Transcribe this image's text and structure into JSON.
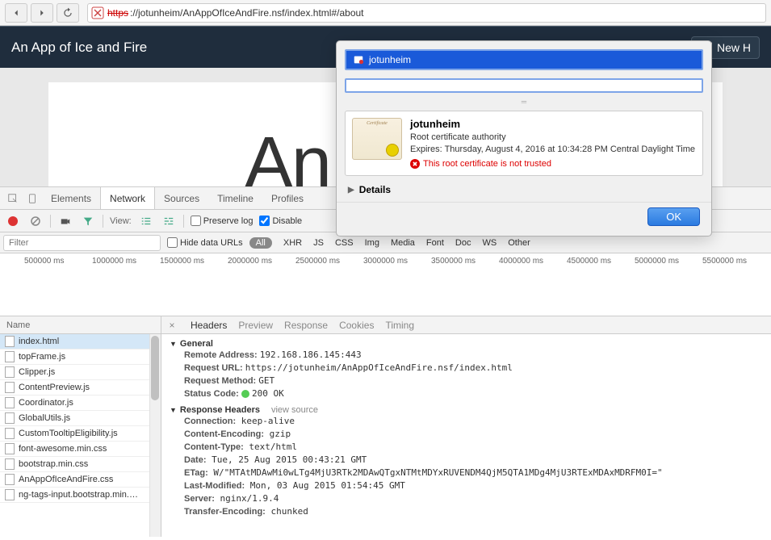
{
  "browser": {
    "url_prefix": "https",
    "url_rest": "://jotunheim/AnAppOfIceAndFire.nsf/index.html#/about"
  },
  "site": {
    "title": "An App of Ice and Fire",
    "new_button": "New H",
    "hero": "An App o"
  },
  "cert": {
    "header_host": "jotunheim",
    "name": "jotunheim",
    "authority": "Root certificate authority",
    "expires": "Expires: Thursday, August 4, 2016 at 10:34:28 PM Central Daylight Time",
    "error": "This root certificate is not trusted",
    "details": "Details",
    "ok": "OK"
  },
  "devtools": {
    "tabs": [
      "Elements",
      "Network",
      "Sources",
      "Timeline",
      "Profiles"
    ],
    "active_tab": 1,
    "toolbar": {
      "view_label": "View:",
      "preserve": "Preserve log",
      "disable": "Disable"
    },
    "filter": {
      "placeholder": "Filter",
      "hide_urls": "Hide data URLs",
      "all": "All",
      "types": [
        "XHR",
        "JS",
        "CSS",
        "Img",
        "Media",
        "Font",
        "Doc",
        "WS",
        "Other"
      ]
    },
    "timeline": [
      "500000 ms",
      "1000000 ms",
      "1500000 ms",
      "2000000 ms",
      "2500000 ms",
      "3000000 ms",
      "3500000 ms",
      "4000000 ms",
      "4500000 ms",
      "5000000 ms",
      "5500000 ms"
    ],
    "name_header": "Name",
    "files": [
      "index.html",
      "topFrame.js",
      "Clipper.js",
      "ContentPreview.js",
      "Coordinator.js",
      "GlobalUtils.js",
      "CustomTooltipEligibility.js",
      "font-awesome.min.css",
      "bootstrap.min.css",
      "AnAppOfIceAndFire.css",
      "ng-tags-input.bootstrap.min.…"
    ],
    "selected_file": 0,
    "detail_tabs": [
      "Headers",
      "Preview",
      "Response",
      "Cookies",
      "Timing"
    ],
    "active_detail": 0,
    "general": {
      "title": "General",
      "remote_addr_k": "Remote Address:",
      "remote_addr_v": "192.168.186.145:443",
      "req_url_k": "Request URL:",
      "req_url_v": "https://jotunheim/AnAppOfIceAndFire.nsf/index.html",
      "req_method_k": "Request Method:",
      "req_method_v": "GET",
      "status_k": "Status Code:",
      "status_v": "200 OK"
    },
    "response_headers": {
      "title": "Response Headers",
      "view_source": "view source",
      "items": [
        {
          "k": "Connection:",
          "v": "keep-alive"
        },
        {
          "k": "Content-Encoding:",
          "v": "gzip"
        },
        {
          "k": "Content-Type:",
          "v": "text/html"
        },
        {
          "k": "Date:",
          "v": "Tue, 25 Aug 2015 00:43:21 GMT"
        },
        {
          "k": "ETag:",
          "v": "W/\"MTAtMDAwMi0wLTg4MjU3RTk2MDAwQTgxNTMtMDYxRUVENDM4QjM5QTA1MDg4MjU3RTExMDAxMDRFM0I=\""
        },
        {
          "k": "Last-Modified:",
          "v": "Mon, 03 Aug 2015 01:54:45 GMT"
        },
        {
          "k": "Server:",
          "v": "nginx/1.9.4"
        },
        {
          "k": "Transfer-Encoding:",
          "v": "chunked"
        }
      ]
    }
  }
}
